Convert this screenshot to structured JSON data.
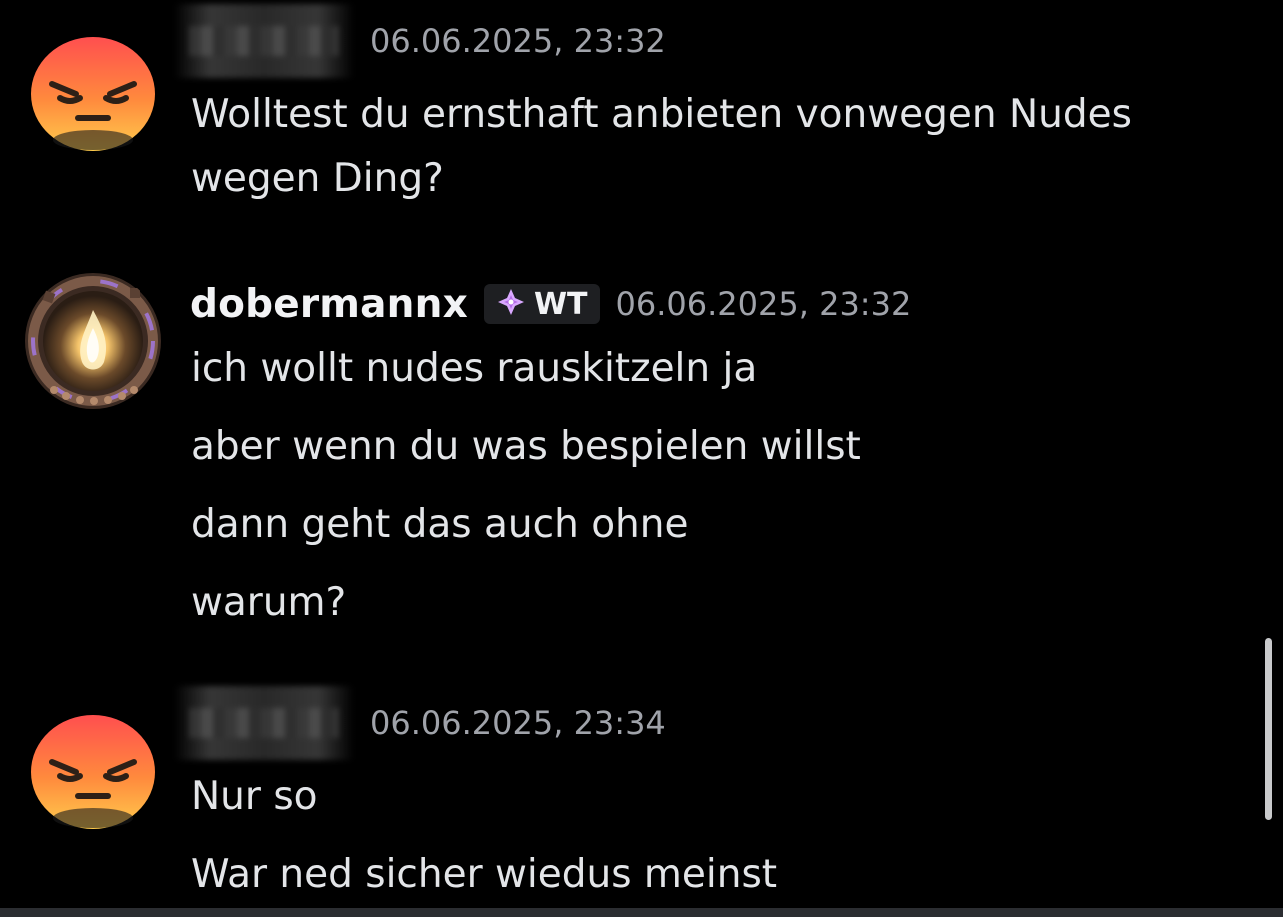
{
  "messages": [
    {
      "username": "",
      "username_blurred": true,
      "avatar": "angry-face-emoji-icon",
      "timestamp": "06.06.2025, 23:32",
      "lines": [
        "Wolltest du ernsthaft anbieten vonwegen Nudes",
        "wegen Ding?"
      ]
    },
    {
      "username": "dobermannx",
      "username_blurred": false,
      "avatar": "fire-portal-avatar",
      "tag": "WT",
      "tag_icon": "sparkle-gem-icon",
      "timestamp": "06.06.2025, 23:32",
      "lines": [
        "ich wollt nudes rauskitzeln ja",
        "aber wenn du was bespielen willst",
        "dann geht das auch ohne",
        "warum?"
      ]
    },
    {
      "username": "",
      "username_blurred": true,
      "avatar": "angry-face-emoji-icon",
      "timestamp": "06.06.2025, 23:34",
      "lines": [
        "Nur so",
        "War ned sicher wiedus meinst"
      ]
    }
  ],
  "colors": {
    "background": "#000000",
    "text": "#e3e5e8",
    "timestamp": "#a0a3aa",
    "tag_bg": "#1e1f22",
    "accent_purple": "#b56ce8"
  }
}
